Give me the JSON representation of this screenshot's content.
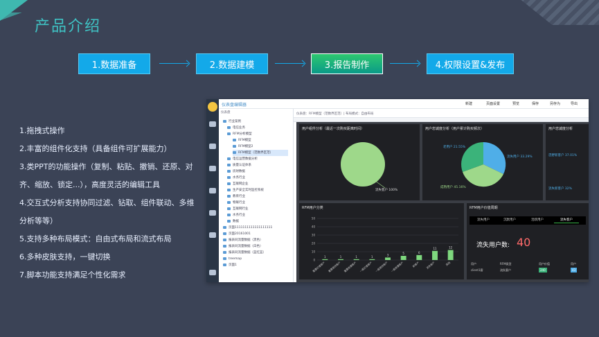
{
  "page": {
    "title": "产品介绍"
  },
  "steps": [
    {
      "label": "1.数据准备"
    },
    {
      "label": "2.数据建模"
    },
    {
      "label": "3.报告制作"
    },
    {
      "label": "4.权限设置&发布"
    }
  ],
  "features": [
    "1.拖拽式操作",
    "2.丰富的组件化支持（具备组件可扩展能力）",
    "3.类PPT的功能操作（复制、粘贴、撤销、还原、对",
    "齐、缩放、锁定...），高度灵活的编辑工具",
    "4.交互式分析支持协同过滤、钻取、组件联动、多维",
    "分析等等）",
    "5.支持多种布局模式：自由式布局和流式布局",
    "6.多种皮肤支持，一键切换",
    "7.脚本功能支持满足个性化需求"
  ],
  "app": {
    "brand": "仪表盘编辑器",
    "toolbar": [
      "新建",
      "页面设置",
      "预览",
      "保存",
      "另存为",
      "导出"
    ],
    "tree_header": "仪表盘",
    "canvas_bar": "仪表盘：RFM模型（范数界区范）| 布局模式：自由布局",
    "tree": [
      "行业案例",
      "电信业务",
      "RFM分析模型",
      "RFM模型",
      "RFM模型2",
      "RFM模型（范数界区范）",
      "电信运营数据分析",
      "质量认证体系",
      "房财数据",
      "水务行业",
      "互联网企业",
      "生产安全实时监控系统",
      "教育行业",
      "物联行业",
      "互联网行业",
      "水务行业",
      "数据",
      "页面1111111111111111111",
      "页面20161001",
      "报表同流量数据（黑色）",
      "报表同流量数据（白色）",
      "报表同流量数据（蓝红蓝）",
      "treemap",
      "页面1"
    ],
    "panels": {
      "pie1_title": "用户组件分析（最近一次购买距离时间）",
      "pie1_label": "流失客户 100%",
      "pie2_title": "用户忠诚度分析（用户累计购买频次）",
      "pie2_labels": [
        "老用户 21.55%",
        "流失用户 33.29%",
        "成熟用户 45.16%"
      ],
      "pie3_title": "用户忠诚度分析",
      "pie3_labels": [
        "忠野新客户 37.01%",
        "流失新客户 32%"
      ],
      "bar_title": "RFM用户分类",
      "value_title": "RFM用户价值周期",
      "value_tabs": [
        "流失用户",
        "沉默用户",
        "活跃用户",
        "流失客户"
      ],
      "value_label": "流失用户数:",
      "value_number": "40",
      "table_headers": [
        "用户",
        "RFM类型",
        "用户价值",
        "用户"
      ],
      "table_row": [
        "client1客",
        "流失客户",
        "240",
        "43"
      ]
    }
  },
  "chart_data": {
    "type": "bar",
    "categories": [
      "重要价值客户",
      "重要保持客户",
      "重要发展客户",
      "一般价值客户",
      "一般保持客户",
      "一般发展客户",
      "新客户",
      "流失客户",
      "其他"
    ],
    "values": [
      1,
      1,
      1,
      1,
      3,
      5,
      6,
      11,
      12
    ],
    "ylim": [
      0,
      50
    ],
    "yticks": [
      0,
      10,
      20,
      30,
      40,
      50
    ],
    "color": "#7ed87e"
  },
  "colors": {
    "accent": "#3fc3c4",
    "step": "#13a9e9",
    "step_active": "#1fb47a",
    "pie_green": "#9ed88a",
    "pie_blue": "#4faee8",
    "pie_teal": "#3bb37a"
  }
}
